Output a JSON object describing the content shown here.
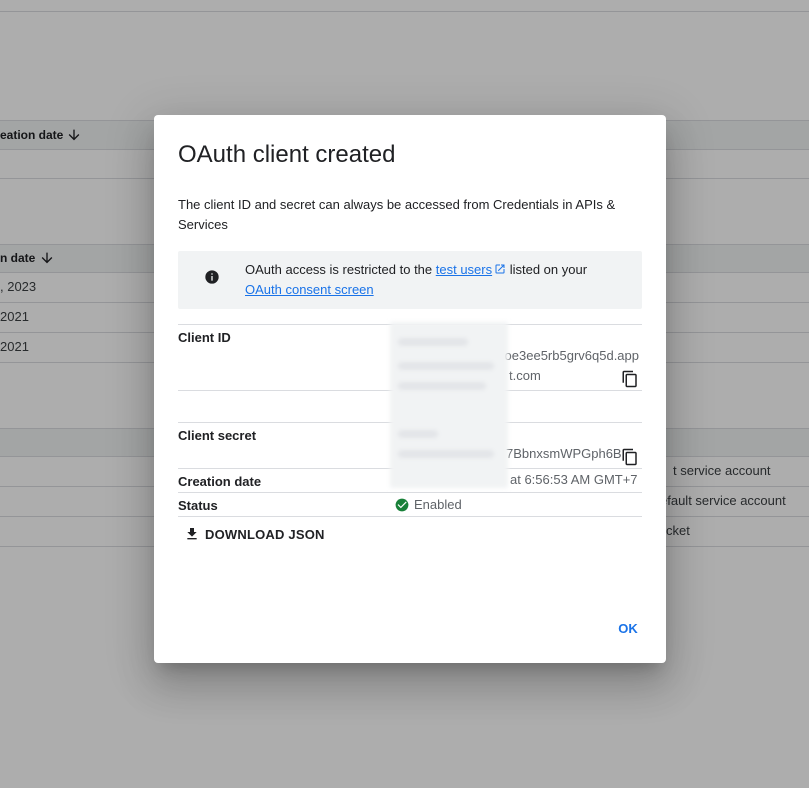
{
  "background": {
    "table1": {
      "header": "eation date"
    },
    "table2": {
      "header": "n date",
      "rows": [
        ", 2023",
        " 2021",
        "2021"
      ]
    },
    "table3": {
      "rows": [
        "t service account",
        "efault service account",
        "cket"
      ]
    }
  },
  "dialog": {
    "title": "OAuth client created",
    "description": "The client ID and secret can always be accessed from Credentials in APIs & Services",
    "notice": {
      "icon": "info-icon",
      "prefix": "OAuth access is restricted to the ",
      "link1": "test users",
      "middle": " listed on your",
      "link2": "OAuth consent screen"
    },
    "client_id": {
      "label": "Client ID",
      "line1": "oe3ee5rb5grv6q5d.app",
      "line2": "t.com"
    },
    "client_secret": {
      "label": "Client secret",
      "value": "7BbnxsmWPGph6B"
    },
    "creation_date": {
      "label": "Creation date",
      "value": "at 6:56:53 AM GMT+7"
    },
    "status": {
      "label": "Status",
      "value": "Enabled",
      "color": "#188038"
    },
    "download_label": "DOWNLOAD JSON",
    "ok_label": "OK"
  },
  "colors": {
    "accent": "#1a73e8",
    "scrim": "rgba(0,0,0,0.32)"
  }
}
